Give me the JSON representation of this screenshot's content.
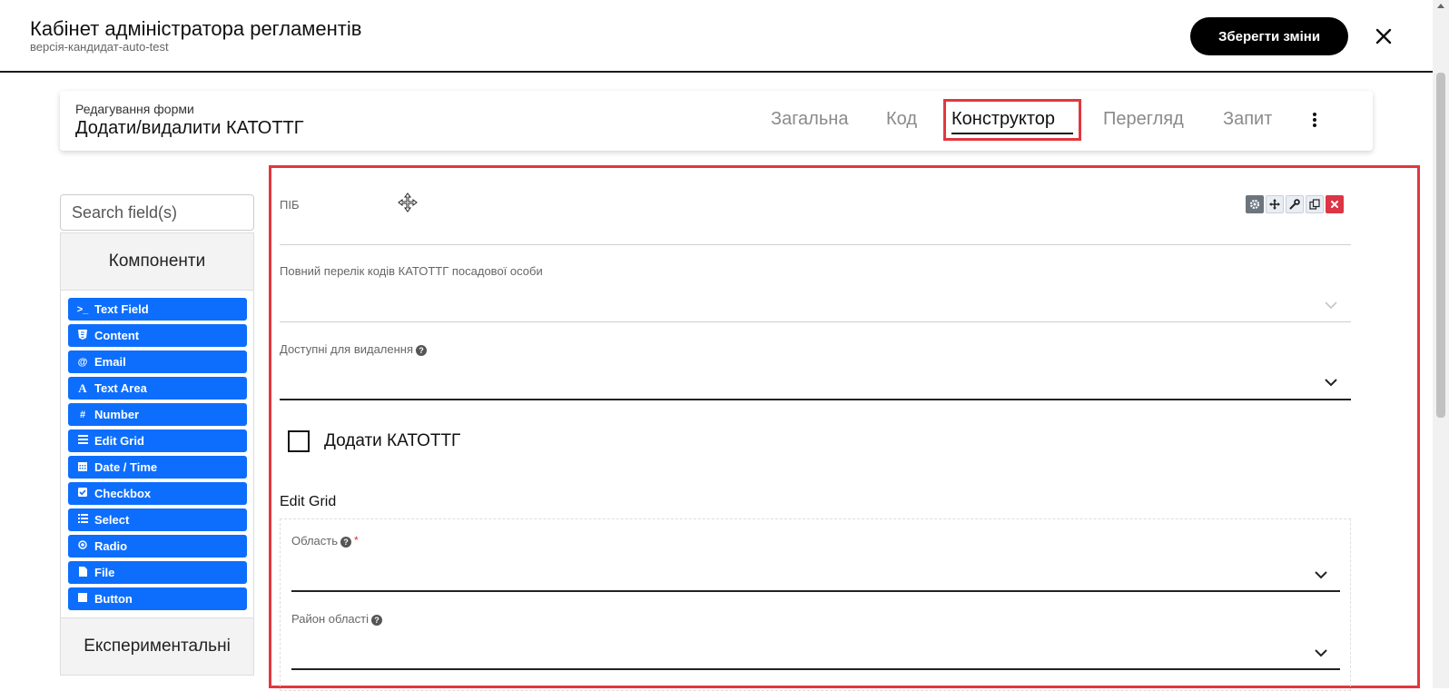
{
  "header": {
    "title": "Кабінет адміністратора регламентів",
    "subtitle": "версія-кандидат-auto-test",
    "save_label": "Зберегти зміни"
  },
  "form_header": {
    "caption": "Редагування форми",
    "name": "Додати/видалити КАТОТТГ",
    "tabs": [
      {
        "label": "Загальна"
      },
      {
        "label": "Код"
      },
      {
        "label": "Конструктор"
      },
      {
        "label": "Перегляд"
      },
      {
        "label": "Запит"
      }
    ],
    "active_tab": "Конструктор"
  },
  "sidebar": {
    "search_placeholder": "Search field(s)",
    "components_title": "Компоненти",
    "experimental_title": "Експериментальні",
    "components": [
      {
        "label": "Text Field",
        "icon": "terminal-icon"
      },
      {
        "label": "Content",
        "icon": "html5-icon"
      },
      {
        "label": "Email",
        "icon": "at-icon"
      },
      {
        "label": "Text Area",
        "icon": "font-icon"
      },
      {
        "label": "Number",
        "icon": "hashtag-icon"
      },
      {
        "label": "Edit Grid",
        "icon": "tasks-icon"
      },
      {
        "label": "Date / Time",
        "icon": "calendar-icon"
      },
      {
        "label": "Checkbox",
        "icon": "check-square-icon"
      },
      {
        "label": "Select",
        "icon": "list-icon"
      },
      {
        "label": "Radio",
        "icon": "dot-circle-icon"
      },
      {
        "label": "File",
        "icon": "file-icon"
      },
      {
        "label": "Button",
        "icon": "stop-icon"
      }
    ]
  },
  "builder": {
    "fields": [
      {
        "label": "ПІБ"
      },
      {
        "label": "Повний перелік кодів КАТОТТГ посадової особи"
      },
      {
        "label": "Доступні для видалення"
      }
    ],
    "checkbox_label": "Додати КАТОТТГ",
    "edit_grid_title": "Edit Grid",
    "grid_fields": [
      {
        "label": "Область"
      },
      {
        "label": "Район області"
      }
    ]
  },
  "colors": {
    "accent": "#0d6efd",
    "highlight": "#e2373e",
    "primary_button": "#000000"
  }
}
